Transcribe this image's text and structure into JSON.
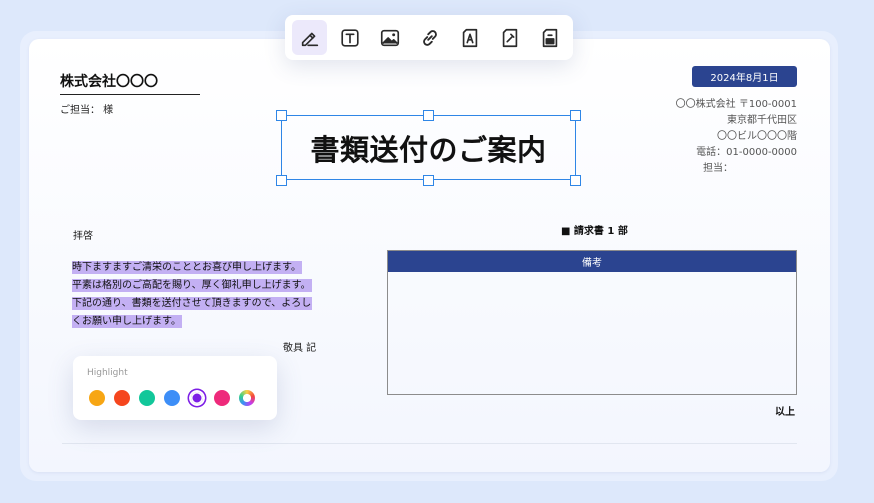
{
  "toolbar": {
    "tools": [
      {
        "name": "signature",
        "icon": "pen-signature-icon",
        "active": true
      },
      {
        "name": "text",
        "icon": "text-box-icon",
        "active": false
      },
      {
        "name": "image",
        "icon": "image-icon",
        "active": false
      },
      {
        "name": "link",
        "icon": "link-icon",
        "active": false
      },
      {
        "name": "font",
        "icon": "font-doc-icon",
        "active": false
      },
      {
        "name": "edit",
        "icon": "edit-doc-icon",
        "active": false
      },
      {
        "name": "stamp",
        "icon": "stamp-icon",
        "active": false
      }
    ]
  },
  "document": {
    "recipient_company": "株式会社〇〇〇",
    "recipient_contact": "ご担当： 様",
    "date": "2024年8月1日",
    "sender": {
      "line1": "〇〇株式会社 〒100-0001",
      "line2": "東京都千代田区",
      "line3": "〇〇ビル〇〇〇階",
      "line4": "電話：01-0000-0000",
      "line5": "担当："
    },
    "title": "書類送付のご案内",
    "greeting": "拝啓",
    "body": [
      "時下ますますご清栄のこととお喜び申し上げます。",
      "平素は格別のご高配を賜り、厚く御礼申し上げます。",
      "下記の通り、書類を送付させて頂きますので、よろし",
      "くお願い申し上げます。"
    ],
    "closing": "敬具 記",
    "enclosure": "■ 請求書 1 部",
    "remarks_header": "備考",
    "end": "以上"
  },
  "highlight_panel": {
    "label": "Highlight",
    "colors": [
      "#f7a614",
      "#f5461e",
      "#12c79a",
      "#3d8ef7",
      "#7d1fe6",
      "#ee2a7b",
      "rainbow"
    ],
    "selected": 4
  },
  "colors": {
    "accent_blue": "#2b4490",
    "selection_blue": "#2f86e6",
    "highlight_purple": "#c3b0f3"
  }
}
